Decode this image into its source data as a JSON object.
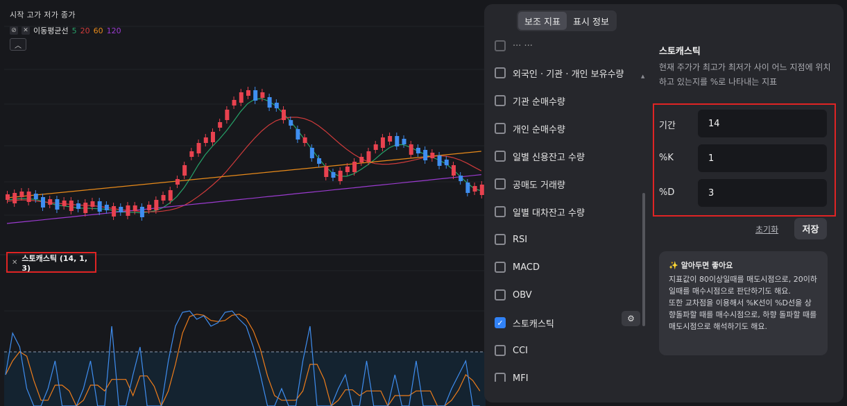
{
  "chart": {
    "ohlc_label": "시작 고가 저가 종가",
    "ma_title": "이동평균선",
    "ma_periods": [
      {
        "label": "5",
        "color": "#26a269"
      },
      {
        "label": "20",
        "color": "#d03b3b"
      },
      {
        "label": "60",
        "color": "#e88a1a"
      },
      {
        "label": "120",
        "color": "#9b3bd0"
      }
    ],
    "stochastic_label": "스토캐스틱 (14, 1, 3)",
    "colors": {
      "up": "#e8424f",
      "down": "#3f8ef0",
      "k_line": "#3f8ef0",
      "d_line": "#ef7d1a"
    }
  },
  "panel": {
    "tabs": [
      {
        "label": "보조 지표",
        "active": true
      },
      {
        "label": "표시 정보",
        "active": false
      }
    ],
    "indicators": [
      {
        "label": "외국인 · 기관 · 개인 보유수량",
        "checked": false
      },
      {
        "label": "기관 순매수량",
        "checked": false
      },
      {
        "label": "개인 순매수량",
        "checked": false
      },
      {
        "label": "일별 신용잔고 수량",
        "checked": false
      },
      {
        "label": "공매도 거래량",
        "checked": false
      },
      {
        "label": "일별 대차잔고 수량",
        "checked": false
      },
      {
        "label": "RSI",
        "checked": false
      },
      {
        "label": "MACD",
        "checked": false
      },
      {
        "label": "OBV",
        "checked": false
      },
      {
        "label": "스토캐스틱",
        "checked": true
      },
      {
        "label": "CCI",
        "checked": false
      },
      {
        "label": "MFI",
        "checked": false
      }
    ],
    "detail": {
      "title": "스토캐스틱",
      "description": "현재 주가가 최고가 최저가 사이 어느 지점에 위치하고 있는지를 %로 나타내는 지표",
      "fields": [
        {
          "label": "기간",
          "value": "14"
        },
        {
          "label": "%K",
          "value": "1"
        },
        {
          "label": "%D",
          "value": "3"
        }
      ],
      "reset_label": "초기화",
      "save_label": "저장",
      "tip_title": "알아두면 좋아요",
      "tip_text_1": "지표값이 80이상일때를 매도시점으로, 20이하일때를 매수시점으로 판단하기도 해요.",
      "tip_text_2": "또한 교차점을 이용해서 %K선이 %D선을 상향돌파할 때를 매수시점으로, 하향 돌파할 때를 매도시점으로 해석하기도 해요."
    }
  }
}
